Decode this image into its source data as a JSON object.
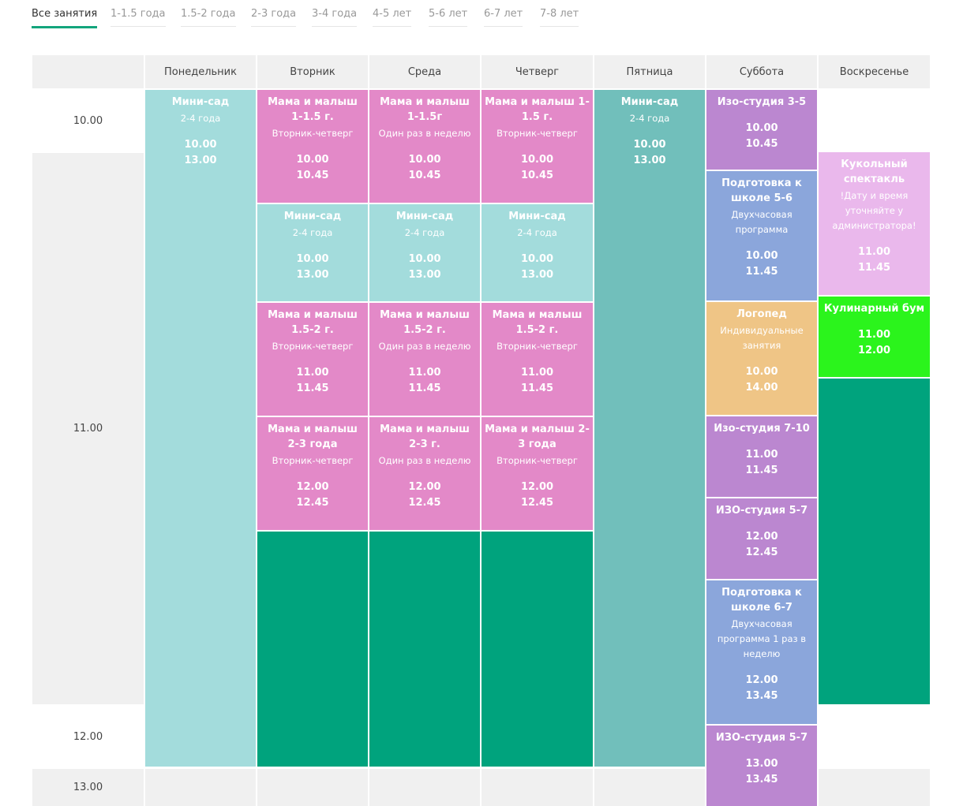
{
  "tabs": [
    "Все занятия",
    "1-1.5 года",
    "1.5-2 года",
    "2-3 года",
    "3-4 года",
    "4-5 лет",
    "5-6 лет",
    "6-7 лет",
    "7-8 лет"
  ],
  "days": [
    "Понедельник",
    "Вторник",
    "Среда",
    "Четверг",
    "Пятница",
    "Суббота",
    "Воскресенье"
  ],
  "times": [
    "10.00",
    "11.00",
    "12.00",
    "13.00"
  ],
  "colors": {
    "pink": "#e389c8",
    "light_teal": "#a3dcdc",
    "teal": "#71bfbb",
    "purple": "#bb87d0",
    "blue": "#8ba6db",
    "orange": "#efc586",
    "light_pink": "#eab8ec",
    "bright_green": "#2bf41c",
    "dark_green": "#00a37d"
  },
  "events": {
    "mon_minisad": {
      "title": "Мини-сад",
      "sub": "2-4 года",
      "t1": "10.00",
      "t2": "13.00"
    },
    "tue_mama1": {
      "title": "Мама и малыш 1-1.5 г.",
      "sub": "Вторник-четверг",
      "t1": "10.00",
      "t2": "10.45"
    },
    "wed_mama1": {
      "title": "Мама и малыш 1-1.5г",
      "sub": "Один раз в неделю",
      "t1": "10.00",
      "t2": "10.45"
    },
    "thu_mama1": {
      "title": "Мама и малыш 1-1.5 г.",
      "sub": "Вторник-четверг",
      "t1": "10.00",
      "t2": "10.45"
    },
    "tue_minisad": {
      "title": "Мини-сад",
      "sub": "2-4 года",
      "t1": "10.00",
      "t2": "13.00"
    },
    "wed_minisad": {
      "title": "Мини-сад",
      "sub": "2-4 года",
      "t1": "10.00",
      "t2": "13.00"
    },
    "thu_minisad": {
      "title": "Мини-сад",
      "sub": "2-4 года",
      "t1": "10.00",
      "t2": "13.00"
    },
    "tue_mama15": {
      "title": "Мама и малыш 1.5-2 г.",
      "sub": "Вторник-четверг",
      "t1": "11.00",
      "t2": "11.45"
    },
    "wed_mama15": {
      "title": "Мама и малыш 1.5-2 г.",
      "sub": "Один раз в неделю",
      "t1": "11.00",
      "t2": "11.45"
    },
    "thu_mama15": {
      "title": "Мама и малыш 1.5-2 г.",
      "sub": "Вторник-четверг",
      "t1": "11.00",
      "t2": "11.45"
    },
    "tue_mama2": {
      "title": "Мама и малыш 2-3 года",
      "sub": "Вторник-четверг",
      "t1": "12.00",
      "t2": "12.45"
    },
    "wed_mama2": {
      "title": "Мама и малыш 2-3 г.",
      "sub": "Один раз в неделю",
      "t1": "12.00",
      "t2": "12.45"
    },
    "thu_mama2": {
      "title": "Мама и малыш 2-3 года",
      "sub": "Вторник-четверг",
      "t1": "12.00",
      "t2": "12.45"
    },
    "fri_minisad": {
      "title": "Мини-сад",
      "sub": "2-4 года",
      "t1": "10.00",
      "t2": "13.00"
    },
    "sat_izo35": {
      "title": "Изо-студия 3-5",
      "t1": "10.00",
      "t2": "10.45"
    },
    "sat_podg56": {
      "title": "Подготовка к школе 5-6",
      "sub": "Двухчасовая программа",
      "t1": "10.00",
      "t2": "11.45"
    },
    "sat_logoped": {
      "title": "Логопед",
      "sub": "Индивидуальные занятия",
      "t1": "10.00",
      "t2": "14.00"
    },
    "sat_izo710": {
      "title": "Изо-студия 7-10",
      "t1": "11.00",
      "t2": "11.45"
    },
    "sat_izo57a": {
      "title": "ИЗО-студия 5-7",
      "t1": "12.00",
      "t2": "12.45"
    },
    "sat_podg67": {
      "title": "Подготовка к школе 6-7",
      "sub": "Двухчасовая программа 1 раз в неделю",
      "t1": "12.00",
      "t2": "13.45"
    },
    "sat_izo57b": {
      "title": "ИЗО-студия 5-7",
      "t1": "13.00",
      "t2": "13.45"
    },
    "sun_kukol": {
      "title": "Кукольный спектакль",
      "sub": "!Дату и время уточняйте у администратора!",
      "t1": "11.00",
      "t2": "11.45"
    },
    "sun_kulinar": {
      "title": "Кулинарный бум",
      "t1": "11.00",
      "t2": "12.00"
    }
  }
}
